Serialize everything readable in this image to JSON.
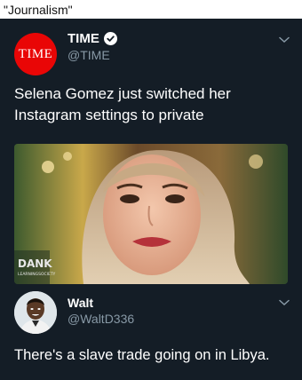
{
  "caption": "\"Journalism\"",
  "tweet1": {
    "avatar_text": "TIME",
    "name": "TIME",
    "handle": "@TIME",
    "text": "Selena Gomez just switched her Instagram settings to private",
    "watermark_top": "DANK",
    "watermark_bottom": "LEARNINGSOCIETY"
  },
  "tweet2": {
    "name": "Walt",
    "handle": "@WaltD336",
    "text": "There's a slave trade going on in Libya."
  },
  "colors": {
    "background": "#141d26",
    "time_red": "#e90606",
    "handle_gray": "#8899a6"
  },
  "icons": [
    "verified-icon",
    "chevron-down-icon"
  ]
}
